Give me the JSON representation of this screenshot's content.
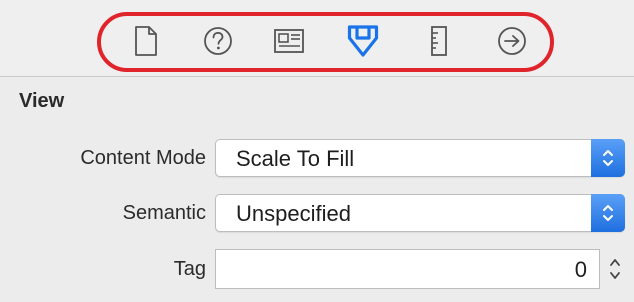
{
  "toolbar": {
    "icons": [
      "file-inspector-icon",
      "quick-help-icon",
      "identity-inspector-icon",
      "attributes-inspector-icon",
      "size-inspector-icon",
      "connections-inspector-icon"
    ],
    "active_color": "#1a73e8",
    "highlight_color": "#e0242b"
  },
  "view": {
    "section_title": "View",
    "content_mode": {
      "label": "Content Mode",
      "value": "Scale To Fill"
    },
    "semantic": {
      "label": "Semantic",
      "value": "Unspecified"
    },
    "tag": {
      "label": "Tag",
      "value": "0"
    }
  }
}
